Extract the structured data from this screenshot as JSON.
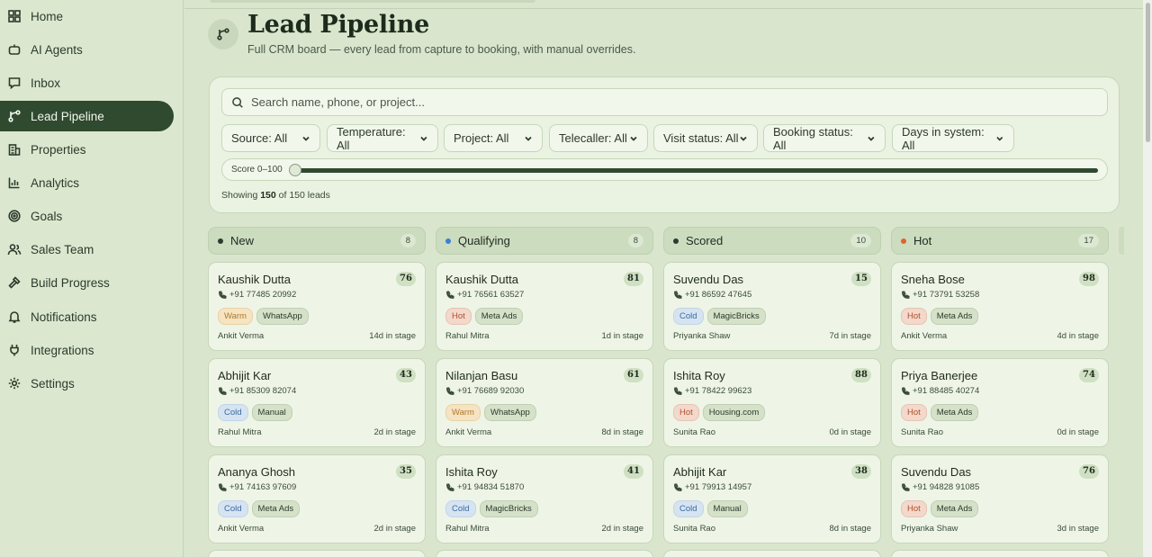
{
  "sidebar": {
    "items": [
      {
        "label": "Home",
        "icon": "home-icon"
      },
      {
        "label": "AI Agents",
        "icon": "bot-icon"
      },
      {
        "label": "Inbox",
        "icon": "inbox-icon"
      },
      {
        "label": "Lead Pipeline",
        "icon": "pipeline-icon",
        "active": true
      },
      {
        "label": "Properties",
        "icon": "building-icon"
      },
      {
        "label": "Analytics",
        "icon": "chart-icon"
      },
      {
        "label": "Goals",
        "icon": "target-icon"
      },
      {
        "label": "Sales Team",
        "icon": "users-icon"
      },
      {
        "label": "Build Progress",
        "icon": "hammer-icon"
      },
      {
        "label": "Notifications",
        "icon": "bell-icon"
      },
      {
        "label": "Integrations",
        "icon": "plug-icon"
      },
      {
        "label": "Settings",
        "icon": "gear-icon"
      }
    ]
  },
  "header": {
    "title": "Lead Pipeline",
    "subtitle": "Full CRM board — every lead from capture to booking, with manual overrides."
  },
  "search": {
    "placeholder": "Search name, phone, or project..."
  },
  "filters": [
    {
      "label": "Source: All"
    },
    {
      "label": "Temperature: All"
    },
    {
      "label": "Project: All"
    },
    {
      "label": "Telecaller: All"
    },
    {
      "label": "Visit status: All"
    },
    {
      "label": "Booking status: All"
    },
    {
      "label": "Days in system: All"
    }
  ],
  "score_filter": {
    "label": "Score 0–100",
    "min": 0,
    "max": 100
  },
  "showing": {
    "prefix": "Showing",
    "count": "150",
    "suffix": "of 150 leads"
  },
  "colors": {
    "accent": "#2f4a2f",
    "new": "#2f3a2f",
    "qualifying": "#3d7dd6",
    "scored": "#2f3a2f",
    "hot": "#e0632e"
  },
  "columns": [
    {
      "title": "New",
      "count": "8",
      "dot": "#2f3a2f",
      "cards": [
        {
          "name": "Kaushik Dutta",
          "score": "76",
          "phone": "+91 77485 20992",
          "temp": "Warm",
          "source": "WhatsApp",
          "owner": "Ankit Verma",
          "stage": "14d in stage"
        },
        {
          "name": "Abhijit Kar",
          "score": "43",
          "phone": "+91 85309 82074",
          "temp": "Cold",
          "source": "Manual",
          "owner": "Rahul Mitra",
          "stage": "2d in stage"
        },
        {
          "name": "Ananya Ghosh",
          "score": "35",
          "phone": "+91 74163 97609",
          "temp": "Cold",
          "source": "Meta Ads",
          "owner": "Ankit Verma",
          "stage": "2d in stage"
        }
      ]
    },
    {
      "title": "Qualifying",
      "count": "8",
      "dot": "#3d7dd6",
      "cards": [
        {
          "name": "Kaushik Dutta",
          "score": "81",
          "phone": "+91 76561 63527",
          "temp": "Hot",
          "source": "Meta Ads",
          "owner": "Rahul Mitra",
          "stage": "1d in stage"
        },
        {
          "name": "Nilanjan Basu",
          "score": "61",
          "phone": "+91 76689 92030",
          "temp": "Warm",
          "source": "WhatsApp",
          "owner": "Ankit Verma",
          "stage": "8d in stage"
        },
        {
          "name": "Ishita Roy",
          "score": "41",
          "phone": "+91 94834 51870",
          "temp": "Cold",
          "source": "MagicBricks",
          "owner": "Rahul Mitra",
          "stage": "2d in stage"
        }
      ]
    },
    {
      "title": "Scored",
      "count": "10",
      "dot": "#2f3a2f",
      "cards": [
        {
          "name": "Suvendu Das",
          "score": "15",
          "phone": "+91 86592 47645",
          "temp": "Cold",
          "source": "MagicBricks",
          "owner": "Priyanka Shaw",
          "stage": "7d in stage"
        },
        {
          "name": "Ishita Roy",
          "score": "88",
          "phone": "+91 78422 99623",
          "temp": "Hot",
          "source": "Housing.com",
          "owner": "Sunita Rao",
          "stage": "0d in stage"
        },
        {
          "name": "Abhijit Kar",
          "score": "38",
          "phone": "+91 79913 14957",
          "temp": "Cold",
          "source": "Manual",
          "owner": "Sunita Rao",
          "stage": "8d in stage"
        }
      ]
    },
    {
      "title": "Hot",
      "count": "17",
      "dot": "#e0632e",
      "cards": [
        {
          "name": "Sneha Bose",
          "score": "98",
          "phone": "+91 73791 53258",
          "temp": "Hot",
          "source": "Meta Ads",
          "owner": "Ankit Verma",
          "stage": "4d in stage"
        },
        {
          "name": "Priya Banerjee",
          "score": "74",
          "phone": "+91 88485 40274",
          "temp": "Hot",
          "source": "Meta Ads",
          "owner": "Sunita Rao",
          "stage": "0d in stage"
        },
        {
          "name": "Suvendu Das",
          "score": "76",
          "phone": "+91 94828 91085",
          "temp": "Hot",
          "source": "Meta Ads",
          "owner": "Priyanka Shaw",
          "stage": "3d in stage"
        }
      ]
    }
  ]
}
